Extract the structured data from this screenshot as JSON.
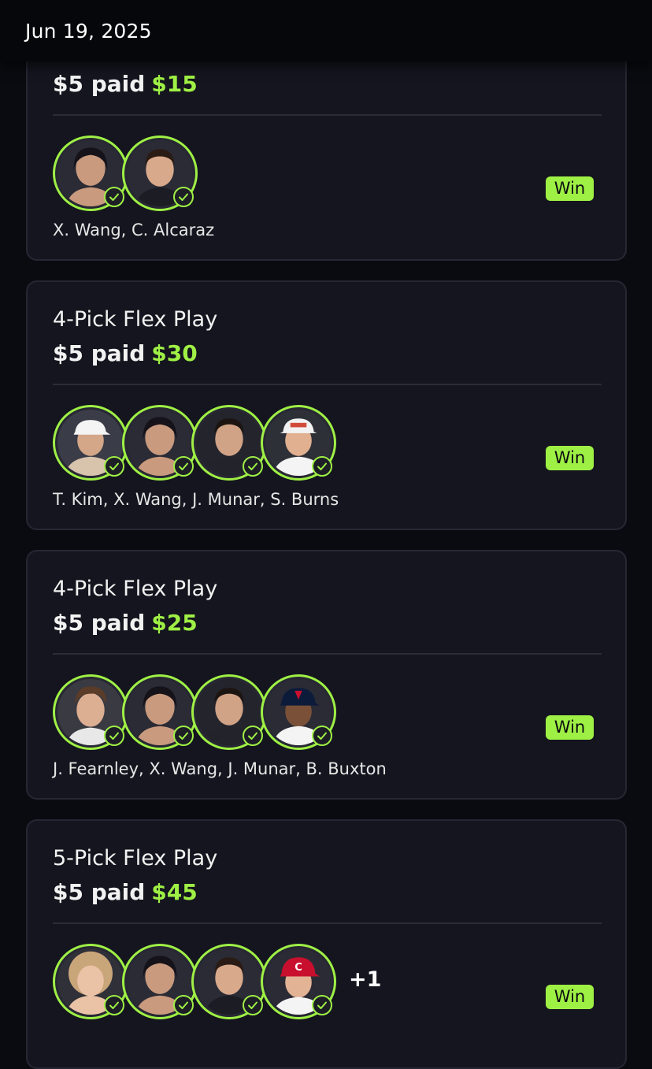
{
  "header": {
    "date": "Jun 19, 2025"
  },
  "colors": {
    "accent": "#9ff045",
    "card": "#14151e",
    "background": "#0a0b10"
  },
  "entries": [
    {
      "title": "",
      "paid": "$5 paid",
      "payout": "$15",
      "players": [
        "avatar-x-wang",
        "avatar-c-alcaraz"
      ],
      "names": "X. Wang, C. Alcaraz",
      "status": "Win"
    },
    {
      "title": "4-Pick Flex Play",
      "paid": "$5 paid",
      "payout": "$30",
      "players": [
        "avatar-t-kim",
        "avatar-x-wang",
        "avatar-j-munar",
        "avatar-s-burns"
      ],
      "names": "T. Kim, X. Wang, J. Munar, S. Burns",
      "status": "Win"
    },
    {
      "title": "4-Pick Flex Play",
      "paid": "$5 paid",
      "payout": "$25",
      "players": [
        "avatar-j-fearnley",
        "avatar-x-wang",
        "avatar-j-munar",
        "avatar-b-buxton"
      ],
      "names": "J. Fearnley, X. Wang, J. Munar, B. Buxton",
      "status": "Win"
    },
    {
      "title": "5-Pick Flex Play",
      "paid": "$5 paid",
      "payout": "$45",
      "players": [
        "avatar-player-1",
        "avatar-x-wang",
        "avatar-c-alcaraz",
        "avatar-player-4"
      ],
      "more": "+1",
      "status": "Win"
    }
  ]
}
